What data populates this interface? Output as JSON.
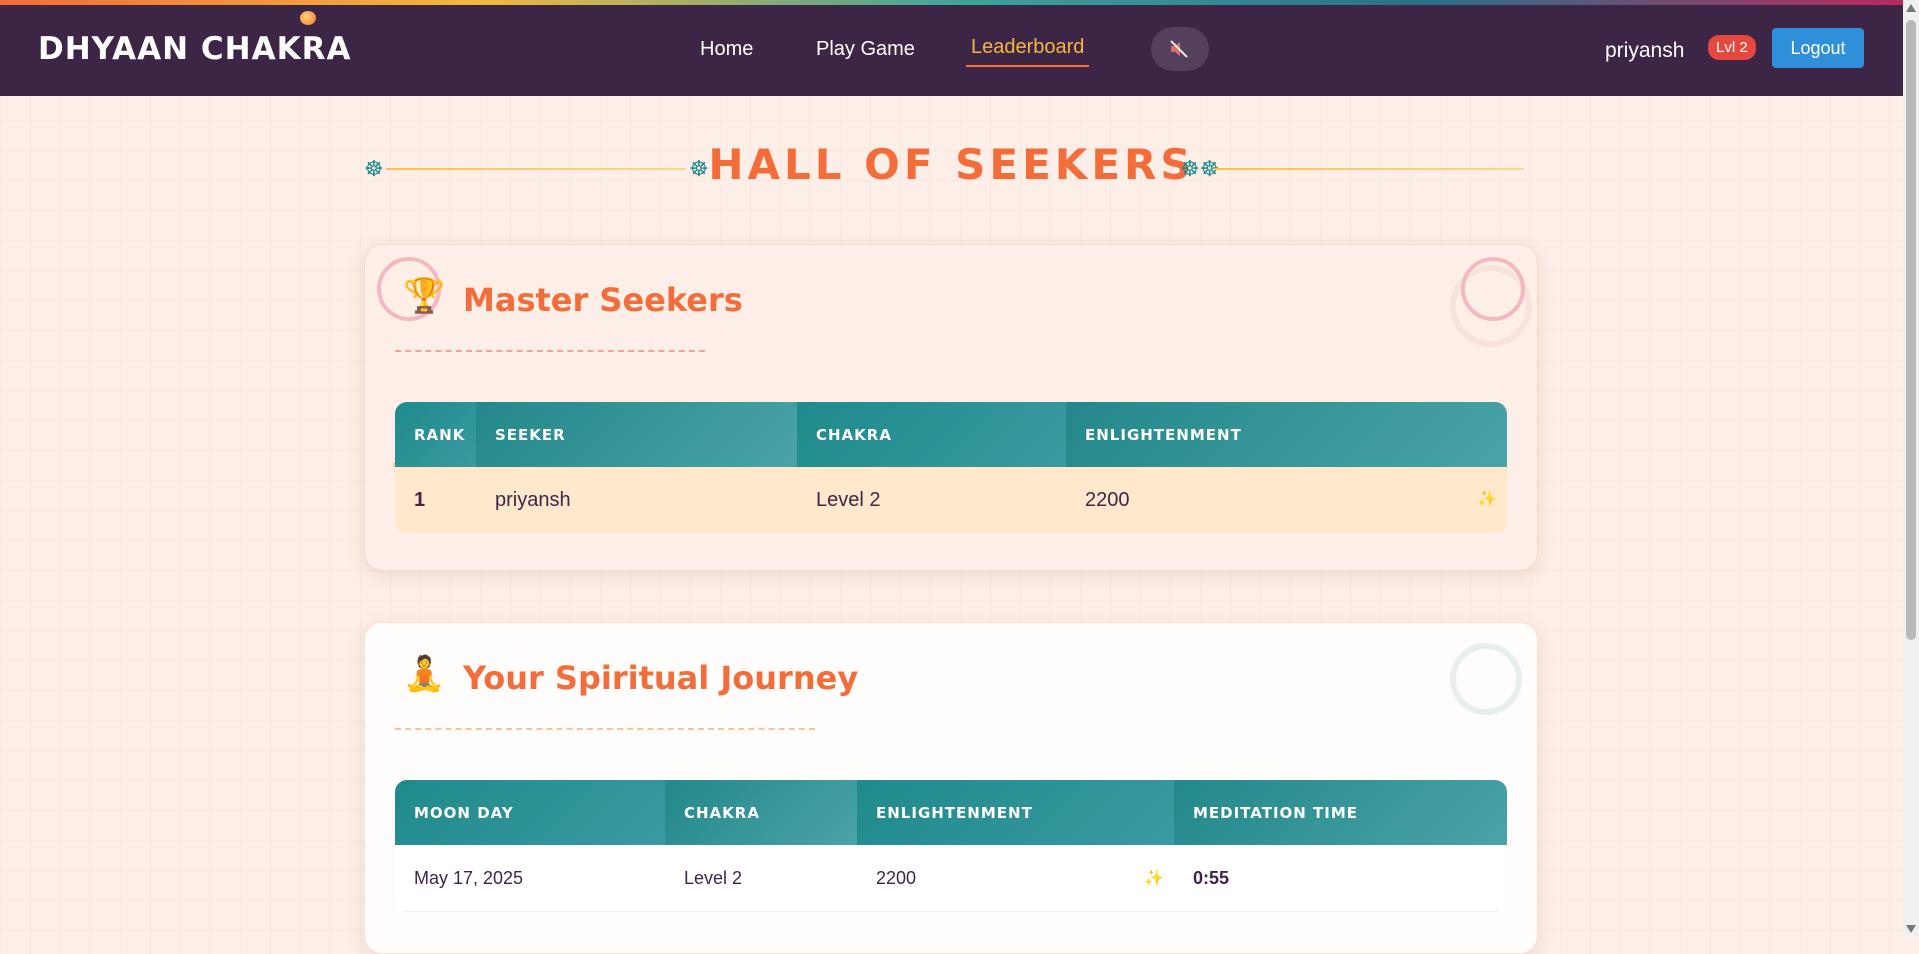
{
  "brand": "DHYAAN CHAKRA",
  "nav": {
    "home": "Home",
    "play": "Play Game",
    "leaderboard": "Leaderboard",
    "user": "priyansh",
    "level_badge": "Lvl 2",
    "logout": "Logout"
  },
  "hall_title": "HALL OF SEEKERS",
  "master": {
    "title": "Master Seekers",
    "icon": "trophy-icon",
    "columns": [
      "RANK",
      "SEEKER",
      "CHAKRA",
      "ENLIGHTENMENT"
    ],
    "rows": [
      {
        "rank": "1",
        "seeker": "priyansh",
        "chakra": "Level 2",
        "enlightenment": "2200"
      }
    ]
  },
  "journey": {
    "title": "Your Spiritual Journey",
    "icon": "meditation-icon",
    "columns": [
      "MOON DAY",
      "CHAKRA",
      "ENLIGHTENMENT",
      "MEDITATION TIME"
    ],
    "rows": [
      {
        "day": "May 17, 2025",
        "chakra": "Level 2",
        "enlightenment": "2200",
        "time": "0:55"
      }
    ]
  },
  "colors": {
    "nav_bg": "#3d2645",
    "accent_orange": "#f26d3a",
    "teal": "#1f8a8c",
    "logout_blue": "#2f8fd8",
    "badge_red": "#e5483f"
  }
}
